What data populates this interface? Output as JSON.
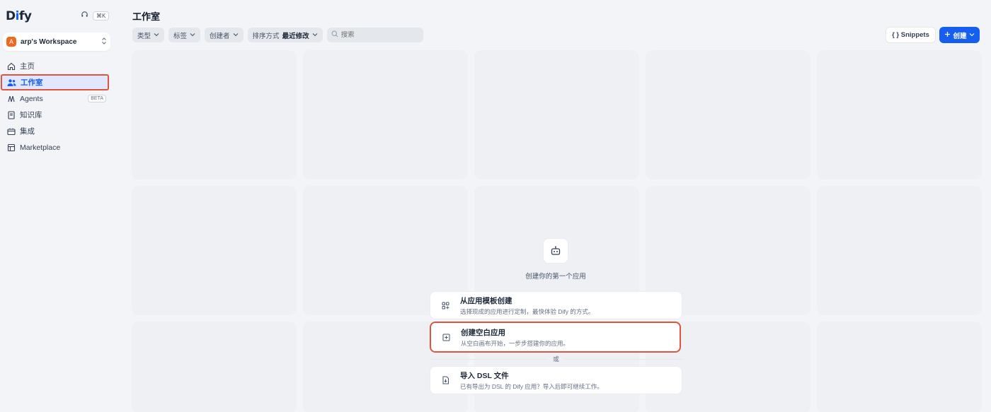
{
  "app": {
    "logo_text_pre": "D",
    "logo_text_i": "i",
    "logo_text_post": "fy",
    "shortcut": "⌘K"
  },
  "workspace": {
    "avatar": "A",
    "name": "arp's Workspace"
  },
  "nav": {
    "items": [
      {
        "label": "主页",
        "icon": "home-icon"
      },
      {
        "label": "工作室",
        "icon": "studio-icon"
      },
      {
        "label": "Agents",
        "icon": "agents-icon",
        "badge": "BETA"
      },
      {
        "label": "知识库",
        "icon": "knowledge-icon"
      },
      {
        "label": "集成",
        "icon": "integration-icon"
      },
      {
        "label": "Marketplace",
        "icon": "marketplace-icon"
      }
    ]
  },
  "header": {
    "title": "工作室"
  },
  "filters": {
    "type": "类型",
    "tags": "标签",
    "creator": "创建者",
    "sort_label": "排序方式",
    "sort_value": "最近修改",
    "search_placeholder": "搜索"
  },
  "actions": {
    "snippets": "{ } Snippets",
    "create": "创建"
  },
  "empty": {
    "title": "创建你的第一个应用",
    "from_template_title": "从应用模板创建",
    "from_template_desc": "选择现成的应用进行定制，最快体验 Dify 的方式。",
    "blank_title": "创建空白应用",
    "blank_desc": "从空白画布开始，一步步搭建你的应用。",
    "or": "或",
    "import_title": "导入 DSL 文件",
    "import_desc": "已有导出为 DSL 的 Dify 应用？导入后即可继续工作。"
  },
  "colors": {
    "accent": "#155eef",
    "highlight_border": "#e0533f",
    "avatar": "#ef6820"
  }
}
